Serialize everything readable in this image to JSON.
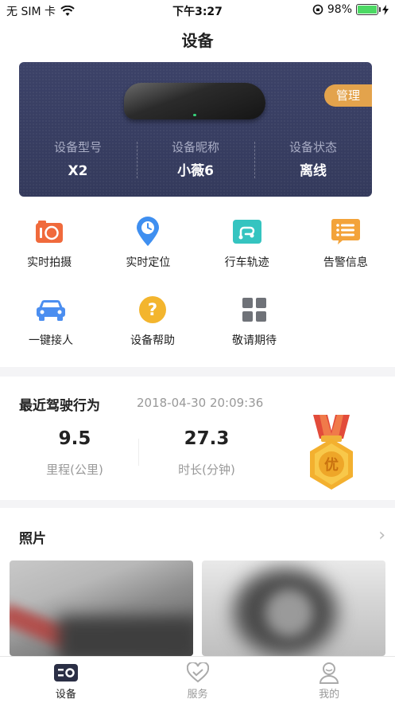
{
  "status_bar": {
    "carrier": "无 SIM 卡",
    "time": "下午3:27",
    "battery": "98%",
    "battery_level": 0.98
  },
  "nav": {
    "title": "设备"
  },
  "device": {
    "manage_label": "管理",
    "model_label": "设备型号",
    "model_value": "X2",
    "nickname_label": "设备昵称",
    "nickname_value": "小薇6",
    "status_label": "设备状态",
    "status_value": "离线"
  },
  "functions": [
    {
      "label": "实时拍摄",
      "icon": "camera-icon",
      "color": "#f06a3c"
    },
    {
      "label": "实时定位",
      "icon": "location-pin-icon",
      "color": "#3f8ff0"
    },
    {
      "label": "行车轨迹",
      "icon": "route-icon",
      "color": "#35c4c0"
    },
    {
      "label": "告警信息",
      "icon": "alert-list-icon",
      "color": "#f3a33a"
    },
    {
      "label": "一键接人",
      "icon": "car-icon",
      "color": "#4b8ef0"
    },
    {
      "label": "设备帮助",
      "icon": "help-icon",
      "color": "#f3b52e"
    },
    {
      "label": "敬请期待",
      "icon": "grid-icon",
      "color": "#6f7278"
    }
  ],
  "driving": {
    "title": "最近驾驶行为",
    "timestamp": "2018-04-30 20:09:36",
    "mileage_value": "9.5",
    "mileage_label": "里程(公里)",
    "duration_value": "27.3",
    "duration_label": "时长(分钟)",
    "medal_text": "优"
  },
  "photos": {
    "title": "照片"
  },
  "tabs": [
    {
      "label": "设备",
      "icon": "device-tab-icon",
      "active": true
    },
    {
      "label": "服务",
      "icon": "heart-icon",
      "active": false
    },
    {
      "label": "我的",
      "icon": "profile-icon",
      "active": false
    }
  ]
}
